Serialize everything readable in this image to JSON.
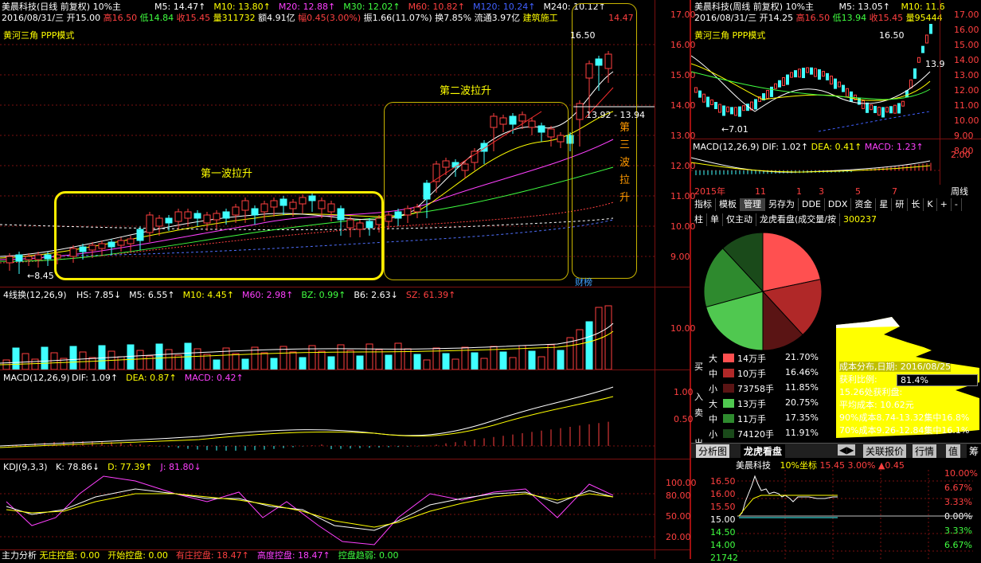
{
  "main": {
    "title": "美晨科技(日线 前复权) 10%主",
    "ma": [
      {
        "label": "M5: 14.47↑",
        "color": "#ffffff"
      },
      {
        "label": "M10: 13.80↑",
        "color": "#ffff00"
      },
      {
        "label": "M20: 12.88↑",
        "color": "#ff40ff"
      },
      {
        "label": "M30: 12.02↑",
        "color": "#40ff40"
      },
      {
        "label": "M60: 10.82↑",
        "color": "#ff4040"
      },
      {
        "label": "M120: 10.24↑",
        "color": "#4060ff"
      },
      {
        "label": "M240: 10.12↑",
        "color": "#ffffff"
      }
    ],
    "quote": {
      "date": "2016/08/31/三",
      "open": "开15.00",
      "high": "高16.50",
      "low": "低14.84",
      "close": "收15.45",
      "vol": "量311732",
      "amount": "额4.91亿",
      "change": "幅0.45(3.00%)",
      "amp": "振1.66(11.07%)",
      "turnover": "换7.85%",
      "float": "流通3.97亿",
      "sector": "建筑施工",
      "last": "14.47"
    },
    "subtitle": "黄河三角 PPP模式",
    "price_axis": [
      "17.00",
      "16.00",
      "15.00",
      "14.00",
      "13.00",
      "12.00",
      "11.00",
      "10.00",
      "9.00"
    ],
    "annotations": {
      "wave1": "第一波拉升",
      "wave2": "第二波拉升",
      "wave3": [
        "第",
        "三",
        "波",
        "拉",
        "升"
      ],
      "low_mark": "8.45",
      "high_mark": "16.50",
      "range_mark": "13.92 - 13.94",
      "finance": "财榜"
    }
  },
  "vol_panel": {
    "title": "4线换(12,26,9)",
    "items": [
      {
        "label": "HS: 7.85↓",
        "color": "#ffffff"
      },
      {
        "label": "M5: 6.55↑",
        "color": "#ffffff"
      },
      {
        "label": "M10: 4.45↑",
        "color": "#ffff00"
      },
      {
        "label": "M60: 2.98↑",
        "color": "#ff40ff"
      },
      {
        "label": "BZ: 0.99↑",
        "color": "#40ff40"
      },
      {
        "label": "B6: 2.63↓",
        "color": "#ffffff"
      },
      {
        "label": "SZ: 61.39↑",
        "color": "#ff4040"
      }
    ],
    "axis": [
      "10.00"
    ]
  },
  "macd_panel": {
    "title": "MACD(12,26,9)",
    "items": [
      {
        "label": "DIF: 1.09↑",
        "color": "#ffffff"
      },
      {
        "label": "DEA: 0.87↑",
        "color": "#ffff00"
      },
      {
        "label": "MACD: 0.42↑",
        "color": "#ff40ff"
      }
    ],
    "axis": [
      "1.00",
      "0.50"
    ]
  },
  "kdj_panel": {
    "title": "KDJ(9,3,3)",
    "items": [
      {
        "label": "K: 78.86↓",
        "color": "#ffffff"
      },
      {
        "label": "D: 77.39↑",
        "color": "#ffff00"
      },
      {
        "label": "J: 81.80↓",
        "color": "#ff40ff"
      }
    ],
    "axis": [
      "100.00",
      "80.00",
      "50.00",
      "20.00"
    ]
  },
  "bottom_bar": {
    "label": "主力分析",
    "items": [
      {
        "label": "无庄控盘: 0.00",
        "color": "#ffff00"
      },
      {
        "label": "开始控盘: 0.00",
        "color": "#ffff00"
      },
      {
        "label": "有庄控盘: 18.47↑",
        "color": "#ff4040"
      },
      {
        "label": "高度控盘: 18.47↑",
        "color": "#ff40ff"
      },
      {
        "label": "控盘趋弱: 0.00",
        "color": "#40ff40"
      }
    ]
  },
  "weekly": {
    "title": "美晨科技(周线 前复权) 10%主",
    "m5": "M5: 13.05↑",
    "m10": "M10: 11.6",
    "date": "2016/08/31/三",
    "open": "开14.25",
    "high": "高16.50",
    "low": "低13.94",
    "close": "收15.45",
    "vol": "量95444",
    "subtitle": "黄河三角 PPP模式",
    "axis": [
      "17.00",
      "16.00",
      "15.00",
      "14.00",
      "13.00",
      "12.00",
      "11.00",
      "10.00",
      "9.00",
      "8.00"
    ],
    "high_mark": "16.50",
    "low_mark": "7.01",
    "right_mark": "13.9",
    "macd_title": "MACD(12,26,9)",
    "macd_dif": "DIF: 1.02↑",
    "macd_dea": "DEA: 0.41↑",
    "macd_val": "MACD: 1.23↑",
    "macd_axis": "2.00",
    "time_labels": [
      "2015年",
      "11",
      "1",
      "3",
      "5",
      "7"
    ],
    "period": "周线"
  },
  "tabs1": [
    "指标",
    "模板",
    "管理",
    "另存为",
    "DDE",
    "DDX",
    "资金",
    "星",
    "研",
    "长",
    "K",
    "+",
    "-"
  ],
  "tabs2": [
    "柱",
    "单",
    "仅主动",
    "龙虎看盘(成交量/按",
    "300237"
  ],
  "pie_table": {
    "buy_label": [
      "买",
      "入"
    ],
    "sell_label": [
      "卖",
      "出"
    ],
    "rows": [
      {
        "side": "大",
        "vol": "14万手",
        "pct": "21.70%",
        "color": "#ff5050"
      },
      {
        "side": "中",
        "vol": "10万手",
        "pct": "16.46%",
        "color": "#b02828"
      },
      {
        "side": "小",
        "vol": "73758手",
        "pct": "11.85%",
        "color": "#5a1414"
      },
      {
        "side": "大",
        "vol": "13万手",
        "pct": "20.75%",
        "color": "#50c850"
      },
      {
        "side": "中",
        "vol": "11万手",
        "pct": "17.35%",
        "color": "#2e8a2e"
      },
      {
        "side": "小",
        "vol": "74120手",
        "pct": "11.91%",
        "color": "#1a4a1a"
      }
    ]
  },
  "cost": {
    "date_label": "成本分布,日期:",
    "date": "2016/08/25",
    "profit_label": "获利比例:",
    "profit": "81.4%",
    "profit_place": "15.26处获利盘:",
    "avg_cost": "平均成本: 10.62元",
    "c90": "90%成本8.74-13.32集中16.8%",
    "c70": "70%成本9.26-12.84集中16.1%"
  },
  "bottom_tabs": {
    "left": [
      "分析图",
      "龙虎看盘"
    ],
    "right": [
      "关联报价",
      "行情",
      "值",
      "筹"
    ]
  },
  "intraday": {
    "title": "美晨科技",
    "coord": "10%坐标",
    "price": "15.45",
    "pct": "3.00%",
    "chg": "▲0.45",
    "left_axis": [
      "16.50",
      "16.00",
      "15.50",
      "15.00",
      "14.50",
      "14.00",
      "21742"
    ],
    "right_axis": [
      "10.00%",
      "6.67%",
      "3.33%",
      "0.00%",
      "3.33%",
      "6.67%"
    ]
  }
}
